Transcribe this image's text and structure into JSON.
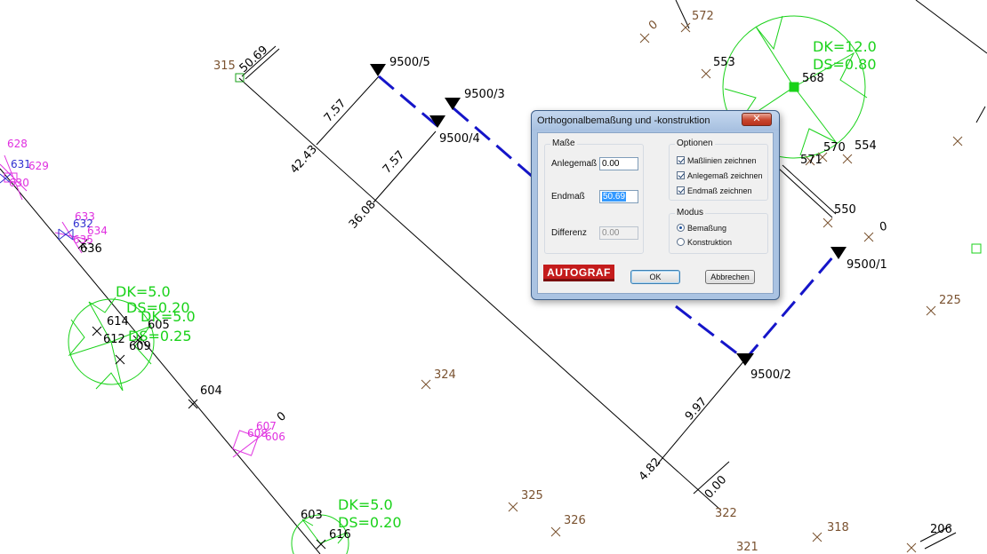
{
  "dialog": {
    "title": "Orthogonalbemaßung und -konstruktion",
    "close_glyph": "✕",
    "masse": {
      "legend": "Maße",
      "anlegemass_label": "Anlegemaß",
      "anlegemass_value": "0.00",
      "endmass_label": "Endmaß",
      "endmass_value": "50.69",
      "differenz_label": "Differenz",
      "differenz_value": "0.00"
    },
    "optionen": {
      "legend": "Optionen",
      "items": [
        {
          "label": "Maßlinien zeichnen",
          "checked": true
        },
        {
          "label": "Anlegemaß zeichnen",
          "checked": true
        },
        {
          "label": "Endmaß zeichnen",
          "checked": true
        }
      ]
    },
    "modus": {
      "legend": "Modus",
      "options": [
        {
          "label": "Bemaßung",
          "selected": true
        },
        {
          "label": "Konstruktion",
          "selected": false
        }
      ]
    },
    "logo_text": "AUTOGRAF",
    "ok_label": "OK",
    "cancel_label": "Abbrechen"
  },
  "drawing": {
    "colors": {
      "point": "#7a5230",
      "line": "#000000",
      "construction": "#1515c9",
      "tree": "#19d219",
      "magenta": "#e030e0",
      "blue_symbol": "#3030d0"
    },
    "survey_points": [
      {
        "id": "p572",
        "label": "572"
      },
      {
        "id": "p0a",
        "label": "0"
      },
      {
        "id": "p553",
        "label": "553"
      },
      {
        "id": "p568",
        "label": "568"
      },
      {
        "id": "p570",
        "label": "570"
      },
      {
        "id": "p554",
        "label": "554"
      },
      {
        "id": "p571",
        "label": "571"
      },
      {
        "id": "p550",
        "label": "550"
      },
      {
        "id": "p0b",
        "label": "0"
      },
      {
        "id": "p225",
        "label": "225"
      },
      {
        "id": "p324",
        "label": "324"
      },
      {
        "id": "p325",
        "label": "325"
      },
      {
        "id": "p326",
        "label": "326"
      },
      {
        "id": "p322",
        "label": "322"
      },
      {
        "id": "p321",
        "label": "321"
      },
      {
        "id": "p318",
        "label": "318"
      },
      {
        "id": "p206",
        "label": "206"
      },
      {
        "id": "p315",
        "label": "315"
      },
      {
        "id": "p604",
        "label": "604"
      },
      {
        "id": "p603",
        "label": "603"
      },
      {
        "id": "p616",
        "label": "616"
      },
      {
        "id": "p614",
        "label": "614"
      },
      {
        "id": "p612",
        "label": "612"
      },
      {
        "id": "p605",
        "label": "605"
      },
      {
        "id": "p609",
        "label": "609"
      },
      {
        "id": "p636",
        "label": "636"
      },
      {
        "id": "p0c",
        "label": "0"
      }
    ],
    "magenta_labels": [
      "628",
      "631",
      "629",
      "630",
      "633",
      "632",
      "634",
      "635",
      "607",
      "608",
      "606"
    ],
    "station_labels": [
      "9500/5",
      "9500/3",
      "9500/4",
      "9500/1",
      "9500/2"
    ],
    "dimensions": [
      "50.69",
      "7.57",
      "7.57",
      "42.43",
      "36.08",
      "9.97",
      "4.82",
      "0.00"
    ],
    "tree_labels": [
      {
        "dk": "DK=12.0",
        "ds": "DS=0.80"
      },
      {
        "dk": "DK=5.0",
        "ds": "DS=0.20"
      },
      {
        "dk": "DK=5.0",
        "ds": "DS=0.25"
      },
      {
        "dk": "DK=5.0",
        "ds": "DS=0.20"
      }
    ]
  }
}
